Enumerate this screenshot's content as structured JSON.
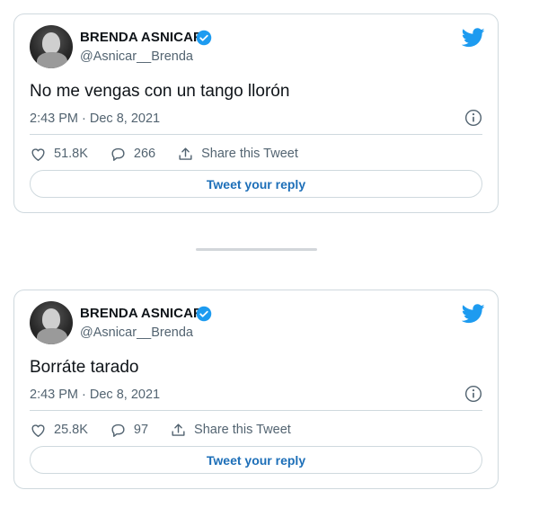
{
  "tweets": [
    {
      "display_name": "BRENDA ASNICAR",
      "handle": "@Asnicar__Brenda",
      "text": "No me vengas con un tango llorón",
      "timestamp": "2:43 PM · Dec 8, 2021",
      "likes": "51.8K",
      "replies": "266",
      "share_label": "Share this Tweet",
      "reply_button": "Tweet your reply"
    },
    {
      "display_name": "BRENDA ASNICAR",
      "handle": "@Asnicar__Brenda",
      "text": "Borráte tarado",
      "timestamp": "2:43 PM · Dec 8, 2021",
      "likes": "25.8K",
      "replies": "97",
      "share_label": "Share this Tweet",
      "reply_button": "Tweet your reply"
    }
  ],
  "icons": {
    "verified": "verified-badge-icon",
    "brand": "twitter-bird-icon",
    "info": "info-icon",
    "like": "heart-icon",
    "reply": "speech-bubble-icon",
    "share": "share-icon"
  },
  "colors": {
    "brand_blue": "#1d9bf0",
    "reply_text": "#1d6fb8",
    "muted_text": "#536471",
    "border": "#cfd9de"
  }
}
